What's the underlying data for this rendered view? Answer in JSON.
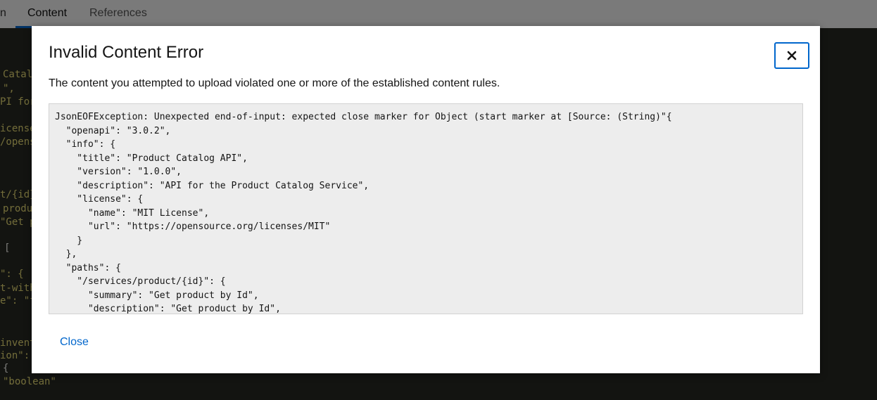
{
  "background": {
    "tabs": [
      {
        "label": "n"
      },
      {
        "label": "Content"
      },
      {
        "label": "References"
      }
    ],
    "code_fragments": [
      "Catal",
      "\",",
      "PI for",
      "icense\"",
      "/opens",
      "t/{id}",
      "produ",
      "\"Get p",
      "[",
      "\": {",
      "t-with",
      "e\": \"f",
      "invent",
      "ion\":",
      "{",
      "\"boolean\""
    ]
  },
  "modal": {
    "title": "Invalid Content Error",
    "message": "The content you attempted to upload violated one or more of the established content rules.",
    "error_text": "JsonEOFException: Unexpected end-of-input: expected close marker for Object (start marker at [Source: (String)\"{\n  \"openapi\": \"3.0.2\",\n  \"info\": {\n    \"title\": \"Product Catalog API\",\n    \"version\": \"1.0.0\",\n    \"description\": \"API for the Product Catalog Service\",\n    \"license\": {\n      \"name\": \"MIT License\",\n      \"url\": \"https://opensource.org/licenses/MIT\"\n    }\n  },\n  \"paths\": {\n    \"/services/product/{id}\": {\n      \"summary\": \"Get product by Id\",\n      \"description\": \"Get product by Id\",",
    "close_link_label": "Close",
    "close_icon": "close-icon"
  },
  "colors": {
    "accent": "#0066cc",
    "editor_bg": "#272822",
    "code_string": "#e6db74"
  }
}
